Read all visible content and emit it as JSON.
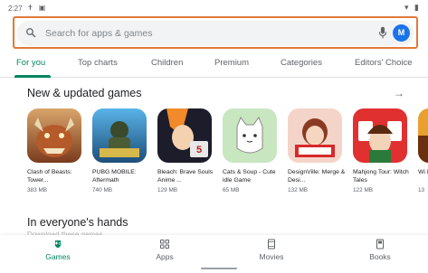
{
  "status_bar": {
    "time": "2:27",
    "left_icons": "✝ ▣",
    "right_icons": "▾ ▮"
  },
  "search": {
    "placeholder": "Search for apps & games",
    "avatar_letter": "M"
  },
  "tabs": [
    {
      "label": "For you",
      "active": true
    },
    {
      "label": "Top charts",
      "active": false
    },
    {
      "label": "Children",
      "active": false
    },
    {
      "label": "Premium",
      "active": false
    },
    {
      "label": "Categories",
      "active": false
    },
    {
      "label": "Editors' Choice",
      "active": false
    }
  ],
  "section_new_games": {
    "title": "New & updated games",
    "arrow": "→"
  },
  "games": [
    {
      "name": "Clash of Beasts: Tower...",
      "size": "383 MB"
    },
    {
      "name": "PUBG MOBILE: Aftermath",
      "size": "740 MB"
    },
    {
      "name": "Bleach: Brave Souls Anime ...",
      "size": "129 MB"
    },
    {
      "name": "Cats & Soup - Cute idle Game",
      "size": "65 MB"
    },
    {
      "name": "DesignVille: Merge & Desi...",
      "size": "132 MB"
    },
    {
      "name": "Mahjong Tour: Witch Tales",
      "size": "122 MB"
    },
    {
      "name": "Wi He",
      "size": "13"
    }
  ],
  "section_everyone": {
    "title": "In everyone's hands",
    "subtitle": "Download these games"
  },
  "bottom_nav": [
    {
      "label": "Games",
      "icon": "gamepad-icon",
      "active": true
    },
    {
      "label": "Apps",
      "icon": "apps-grid-icon",
      "active": false
    },
    {
      "label": "Movies",
      "icon": "movie-icon",
      "active": false
    },
    {
      "label": "Books",
      "icon": "book-icon",
      "active": false
    }
  ],
  "colors": {
    "accent": "#01875f",
    "highlight_border": "#e07a3a",
    "avatar": "#1a73e8"
  }
}
